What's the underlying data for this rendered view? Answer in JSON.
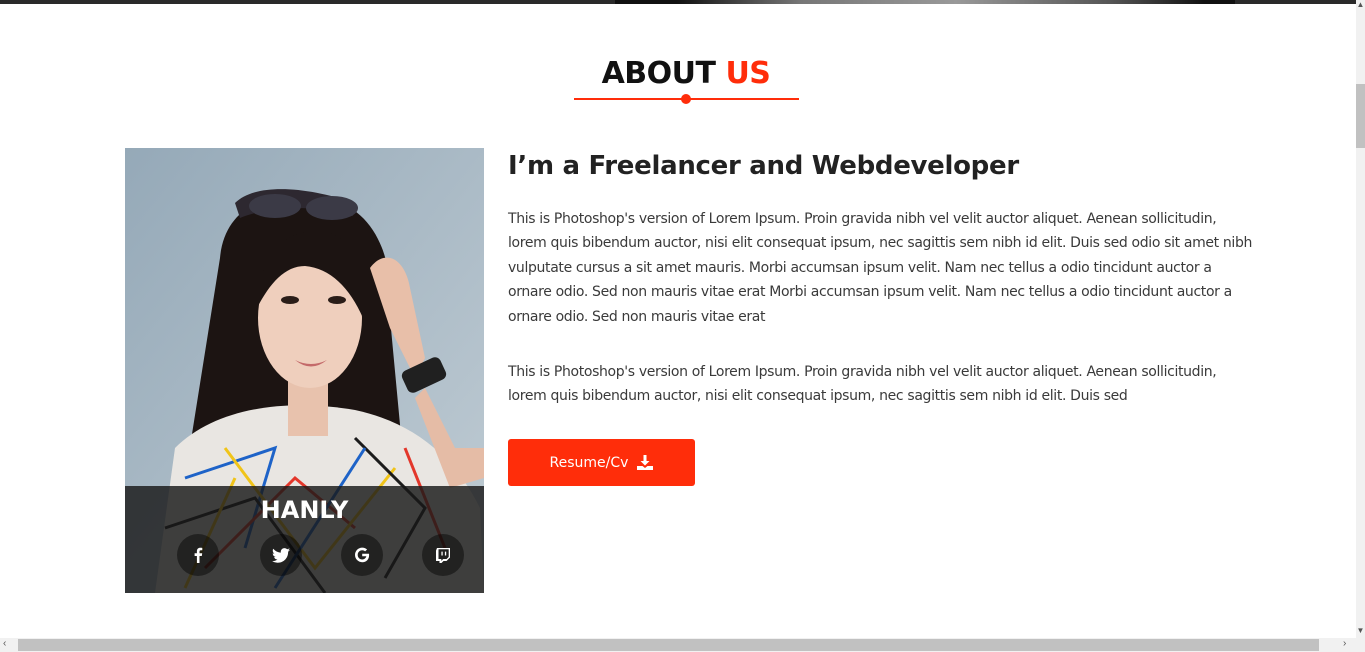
{
  "section": {
    "title_main": "ABOUT ",
    "title_accent": "US",
    "accent_color": "#ff2d0a"
  },
  "profile": {
    "name": "HANLY",
    "socials": [
      {
        "icon": "facebook-icon",
        "glyph": "f"
      },
      {
        "icon": "twitter-icon",
        "glyph": "bird"
      },
      {
        "icon": "google-icon",
        "glyph": "G"
      },
      {
        "icon": "twitch-icon",
        "glyph": "twitch"
      }
    ]
  },
  "about": {
    "heading": "I’m a Freelancer and Webdeveloper",
    "paragraph1": "This is Photoshop's version of Lorem Ipsum. Proin gravida nibh vel velit auctor aliquet. Aenean sollicitudin, lorem quis bibendum auctor, nisi elit consequat ipsum, nec sagittis sem nibh id elit. Duis sed odio sit amet nibh vulputate cursus a sit amet mauris. Morbi accumsan ipsum velit. Nam nec tellus a odio tincidunt auctor a ornare odio. Sed non mauris vitae erat Morbi accumsan ipsum velit. Nam nec tellus a odio tincidunt auctor a ornare odio. Sed non mauris vitae erat",
    "paragraph2": "This is Photoshop's version of Lorem Ipsum. Proin gravida nibh vel velit auctor aliquet. Aenean sollicitudin, lorem quis bibendum auctor, nisi elit consequat ipsum, nec sagittis sem nibh id elit. Duis sed",
    "button_label": "Resume/Cv",
    "button_icon": "download-icon"
  }
}
